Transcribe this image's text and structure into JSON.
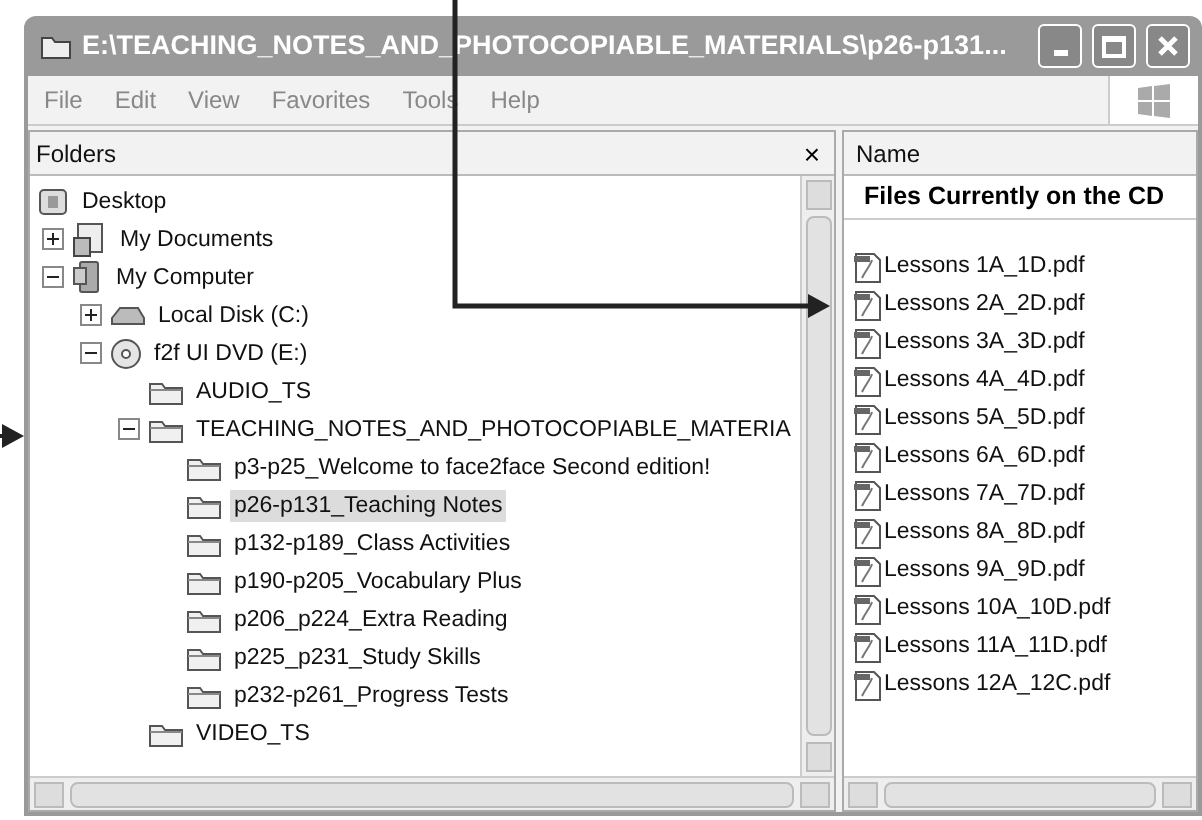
{
  "window": {
    "title": "E:\\TEACHING_NOTES_AND_PHOTOCOPIABLE_MATERIALS\\p26-p131..."
  },
  "menu": [
    "File",
    "Edit",
    "View",
    "Favorites",
    "Tools",
    "Help"
  ],
  "folders_pane": {
    "title": "Folders",
    "close": "×",
    "tree": [
      {
        "label": "Desktop",
        "kind": "desktop",
        "selected": false,
        "children": [
          {
            "label": "My Documents",
            "kind": "documents",
            "expanded": false,
            "selected": false
          },
          {
            "label": "My Computer",
            "kind": "computer",
            "expanded": true,
            "selected": false,
            "children": [
              {
                "label": "Local Disk (C:)",
                "kind": "disk",
                "expanded": false,
                "selected": false
              },
              {
                "label": "f2f UI DVD (E:)",
                "kind": "dvd",
                "expanded": true,
                "selected": false,
                "children": [
                  {
                    "label": "AUDIO_TS",
                    "kind": "folder",
                    "selected": false
                  },
                  {
                    "label": "TEACHING_NOTES_AND_PHOTOCOPIABLE_MATERIA",
                    "kind": "folder",
                    "expanded": true,
                    "selected": false,
                    "children": [
                      {
                        "label": "p3-p25_Welcome to face2face Second edition!",
                        "kind": "folder",
                        "selected": false
                      },
                      {
                        "label": "p26-p131_Teaching Notes",
                        "kind": "folder",
                        "selected": true
                      },
                      {
                        "label": "p132-p189_Class Activities",
                        "kind": "folder",
                        "selected": false
                      },
                      {
                        "label": "p190-p205_Vocabulary Plus",
                        "kind": "folder",
                        "selected": false
                      },
                      {
                        "label": "p206_p224_Extra Reading",
                        "kind": "folder",
                        "selected": false
                      },
                      {
                        "label": "p225_p231_Study Skills",
                        "kind": "folder",
                        "selected": false
                      },
                      {
                        "label": "p232-p261_Progress Tests",
                        "kind": "folder",
                        "selected": false
                      }
                    ]
                  },
                  {
                    "label": "VIDEO_TS",
                    "kind": "folder",
                    "selected": false
                  }
                ]
              }
            ]
          }
        ]
      }
    ]
  },
  "files_pane": {
    "columns": [
      "Name"
    ],
    "group": "Files Currently on the CD",
    "files": [
      "Lessons 1A_1D.pdf",
      "Lessons 2A_2D.pdf",
      "Lessons 3A_3D.pdf",
      "Lessons 4A_4D.pdf",
      "Lessons 5A_5D.pdf",
      "Lessons 6A_6D.pdf",
      "Lessons 7A_7D.pdf",
      "Lessons 8A_8D.pdf",
      "Lessons 9A_9D.pdf",
      "Lessons 10A_10D.pdf",
      "Lessons 11A_11D.pdf",
      "Lessons 12A_12C.pdf"
    ]
  }
}
